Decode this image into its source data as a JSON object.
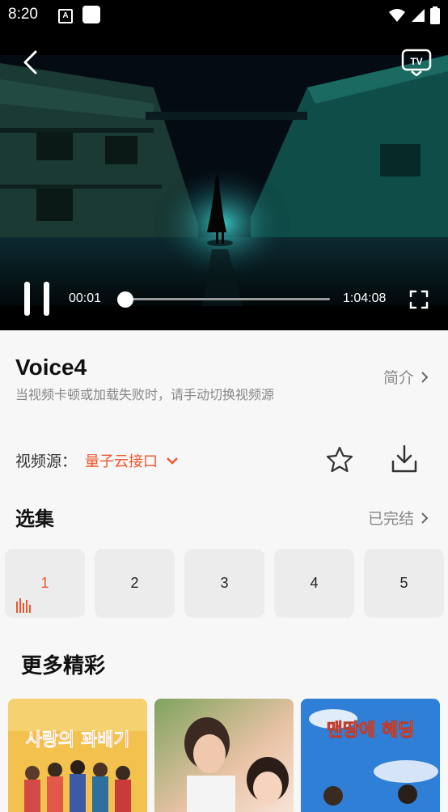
{
  "status_bar": {
    "time": "8:20",
    "notification_icon": "A"
  },
  "player": {
    "current_time": "00:01",
    "total_time": "1:04:08",
    "progress": 0.0,
    "tv_label": "TV"
  },
  "show": {
    "title": "Voice4",
    "intro_label": "简介",
    "hint": "当视频卡顿或加载失败时，请手动切换视频源",
    "source_label": "视频源：",
    "source_value": "量子云接口"
  },
  "episodes": {
    "title": "选集",
    "status": "已完结",
    "items": [
      "1",
      "2",
      "3",
      "4",
      "5"
    ],
    "active_index": 0
  },
  "more": {
    "title": "更多精彩",
    "posters": [
      {
        "title_text": "사랑의 꽈배기",
        "bg": "#f2c14e"
      },
      {
        "title_text": "",
        "bg": "#e8b8a0"
      },
      {
        "title_text": "맨땅에 헤딩",
        "bg": "#2f7fd6"
      }
    ]
  },
  "colors": {
    "accent": "#f0562d",
    "muted_text": "#888888",
    "tile_bg": "#ececec"
  },
  "icons": [
    "back-arrow-icon",
    "tv-cast-icon",
    "pause-icon",
    "fullscreen-icon",
    "chevron-right-icon",
    "chevron-down-icon",
    "star-icon",
    "download-icon",
    "playing-bars-icon",
    "wifi-icon",
    "signal-icon",
    "battery-icon"
  ]
}
